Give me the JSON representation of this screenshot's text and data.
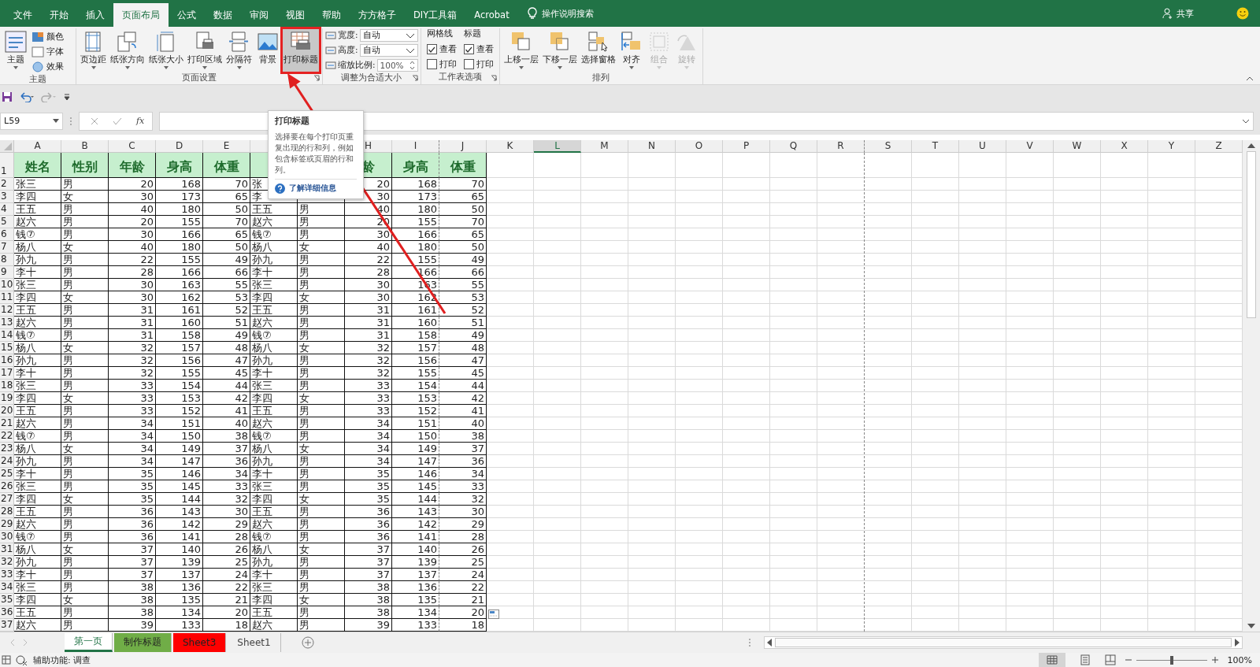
{
  "title_bar": {
    "tabs": [
      {
        "label": "文件",
        "selected": false
      },
      {
        "label": "开始",
        "selected": false
      },
      {
        "label": "插入",
        "selected": false
      },
      {
        "label": "页面布局",
        "selected": true
      },
      {
        "label": "公式",
        "selected": false
      },
      {
        "label": "数据",
        "selected": false
      },
      {
        "label": "审阅",
        "selected": false
      },
      {
        "label": "视图",
        "selected": false
      },
      {
        "label": "帮助",
        "selected": false
      },
      {
        "label": "方方格子",
        "selected": false
      },
      {
        "label": "DIY工具箱",
        "selected": false
      },
      {
        "label": "Acrobat",
        "selected": false
      }
    ],
    "search": "操作说明搜索",
    "share": "共享"
  },
  "ribbon": {
    "theme": {
      "label": "主题",
      "button": "主题",
      "small": [
        "颜色",
        "字体",
        "效果"
      ]
    },
    "page_setup": {
      "label": "页面设置",
      "buttons": [
        {
          "label": "页边距",
          "highlighted": false
        },
        {
          "label": "纸张方向",
          "highlighted": false
        },
        {
          "label": "纸张大小",
          "highlighted": false
        },
        {
          "label": "打印区域",
          "highlighted": false
        },
        {
          "label": "分隔符",
          "highlighted": false
        },
        {
          "label": "背景",
          "highlighted": false
        },
        {
          "label": "打印标题",
          "highlighted": true
        }
      ]
    },
    "fit": {
      "label": "调整为合适大小",
      "fields": [
        {
          "label": "宽度:",
          "value": "自动",
          "kind": "dropdown"
        },
        {
          "label": "高度:",
          "value": "自动",
          "kind": "dropdown"
        },
        {
          "label": "缩放比例:",
          "value": "100%",
          "kind": "spinner"
        }
      ]
    },
    "sheet_options": {
      "label": "工作表选项",
      "columns": [
        {
          "title": "网格线",
          "options": [
            {
              "label": "查看",
              "checked": true
            },
            {
              "label": "打印",
              "checked": false
            }
          ]
        },
        {
          "title": "标题",
          "options": [
            {
              "label": "查看",
              "checked": true
            },
            {
              "label": "打印",
              "checked": false
            }
          ]
        }
      ]
    },
    "arrange": {
      "label": "排列",
      "buttons": [
        {
          "label": "上移一层",
          "disabled": false
        },
        {
          "label": "下移一层",
          "disabled": false
        },
        {
          "label": "选择窗格",
          "disabled": false
        },
        {
          "label": "对齐",
          "disabled": false
        },
        {
          "label": "组合",
          "disabled": true
        },
        {
          "label": "旋转",
          "disabled": true
        }
      ]
    }
  },
  "formula_bar": {
    "name_box": "L59",
    "function_label": "fx"
  },
  "tooltip": {
    "title": "打印标题",
    "body": "选择要在每个打印页重复出现的行和列，例如包含标签或页眉的行和列。",
    "link": "了解详细信息"
  },
  "sheet": {
    "columns": [
      {
        "letter": "A",
        "kind": "text",
        "selected": false,
        "page_break": false
      },
      {
        "letter": "B",
        "kind": "text",
        "selected": false,
        "page_break": false
      },
      {
        "letter": "C",
        "kind": "number",
        "selected": false,
        "page_break": false
      },
      {
        "letter": "D",
        "kind": "number",
        "selected": false,
        "page_break": false
      },
      {
        "letter": "E",
        "kind": "number",
        "selected": false,
        "page_break": false
      },
      {
        "kind": "text"
      },
      {
        "kind": "text"
      },
      {
        "letter": "H",
        "kind": "number",
        "selected": false,
        "page_break": false
      },
      {
        "letter": "I",
        "kind": "number",
        "selected": false,
        "page_break": true
      },
      {
        "letter": "J",
        "kind": "number",
        "selected": false,
        "page_break": false
      },
      {
        "letter": "K",
        "selected": false,
        "page_break": false
      },
      {
        "letter": "L",
        "selected": true,
        "page_break": false
      },
      {
        "letter": "M",
        "selected": false,
        "page_break": false
      },
      {
        "letter": "N",
        "selected": false,
        "page_break": false
      },
      {
        "letter": "O",
        "selected": false,
        "page_break": false
      },
      {
        "letter": "P",
        "selected": false,
        "page_break": false
      },
      {
        "letter": "Q",
        "selected": false,
        "page_break": false
      },
      {
        "letter": "R",
        "selected": false,
        "page_break": true
      },
      {
        "letter": "S",
        "selected": false,
        "page_break": false
      },
      {
        "letter": "T",
        "selected": false,
        "page_break": false
      },
      {
        "letter": "U",
        "selected": false,
        "page_break": false
      },
      {
        "letter": "V",
        "selected": false,
        "page_break": false
      },
      {
        "letter": "W",
        "selected": false,
        "page_break": false
      },
      {
        "letter": "X",
        "selected": false,
        "page_break": false
      },
      {
        "letter": "Y",
        "selected": false,
        "page_break": false
      },
      {
        "letter": "Z",
        "selected": false,
        "page_break": false
      }
    ],
    "rows": [
      {
        "number": "1",
        "kind": "header",
        "cells": [
          "姓名",
          "性别",
          "年龄",
          "身高",
          "体重",
          null,
          null,
          "龄",
          "身高",
          "体重"
        ]
      },
      {
        "number": "2",
        "kind": "data",
        "cells": [
          "张三",
          "男",
          "20",
          "168",
          "70",
          "张",
          null,
          "20",
          "168",
          "70"
        ]
      },
      {
        "number": "3",
        "kind": "data",
        "cells": [
          "李四",
          "女",
          "30",
          "173",
          "65",
          "李",
          null,
          "30",
          "173",
          "65"
        ]
      },
      {
        "number": "4",
        "kind": "data",
        "cells": [
          "王五",
          "男",
          "40",
          "180",
          "50",
          "王五",
          "男",
          "40",
          "180",
          "50"
        ]
      },
      {
        "number": "5",
        "kind": "data",
        "cells": [
          "赵六",
          "男",
          "20",
          "155",
          "70",
          "赵六",
          "男",
          "20",
          "155",
          "70"
        ]
      },
      {
        "number": "6",
        "kind": "data",
        "cells": [
          "钱⑦",
          "男",
          "30",
          "166",
          "65",
          "钱⑦",
          "男",
          "30",
          "166",
          "65"
        ]
      },
      {
        "number": "7",
        "kind": "data",
        "cells": [
          "杨八",
          "女",
          "40",
          "180",
          "50",
          "杨八",
          "女",
          "40",
          "180",
          "50"
        ]
      },
      {
        "number": "8",
        "kind": "data",
        "cells": [
          "孙九",
          "男",
          "22",
          "155",
          "49",
          "孙九",
          "男",
          "22",
          "155",
          "49"
        ]
      },
      {
        "number": "9",
        "kind": "data",
        "cells": [
          "李十",
          "男",
          "28",
          "166",
          "66",
          "李十",
          "男",
          "28",
          "166",
          "66"
        ]
      },
      {
        "number": "10",
        "kind": "data",
        "cells": [
          "张三",
          "男",
          "30",
          "163",
          "55",
          "张三",
          "男",
          "30",
          "163",
          "55"
        ]
      },
      {
        "number": "11",
        "kind": "data",
        "cells": [
          "李四",
          "女",
          "30",
          "162",
          "53",
          "李四",
          "女",
          "30",
          "162",
          "53"
        ]
      },
      {
        "number": "12",
        "kind": "data",
        "cells": [
          "王五",
          "男",
          "31",
          "161",
          "52",
          "王五",
          "男",
          "31",
          "161",
          "52"
        ]
      },
      {
        "number": "13",
        "kind": "data",
        "cells": [
          "赵六",
          "男",
          "31",
          "160",
          "51",
          "赵六",
          "男",
          "31",
          "160",
          "51"
        ]
      },
      {
        "number": "14",
        "kind": "data",
        "cells": [
          "钱⑦",
          "男",
          "31",
          "158",
          "49",
          "钱⑦",
          "男",
          "31",
          "158",
          "49"
        ]
      },
      {
        "number": "15",
        "kind": "data",
        "cells": [
          "杨八",
          "女",
          "32",
          "157",
          "48",
          "杨八",
          "女",
          "32",
          "157",
          "48"
        ]
      },
      {
        "number": "16",
        "kind": "data",
        "cells": [
          "孙九",
          "男",
          "32",
          "156",
          "47",
          "孙九",
          "男",
          "32",
          "156",
          "47"
        ]
      },
      {
        "number": "17",
        "kind": "data",
        "cells": [
          "李十",
          "男",
          "32",
          "155",
          "45",
          "李十",
          "男",
          "32",
          "155",
          "45"
        ]
      },
      {
        "number": "18",
        "kind": "data",
        "cells": [
          "张三",
          "男",
          "33",
          "154",
          "44",
          "张三",
          "男",
          "33",
          "154",
          "44"
        ]
      },
      {
        "number": "19",
        "kind": "data",
        "cells": [
          "李四",
          "女",
          "33",
          "153",
          "42",
          "李四",
          "女",
          "33",
          "153",
          "42"
        ]
      },
      {
        "number": "20",
        "kind": "data",
        "cells": [
          "王五",
          "男",
          "33",
          "152",
          "41",
          "王五",
          "男",
          "33",
          "152",
          "41"
        ]
      },
      {
        "number": "21",
        "kind": "data",
        "cells": [
          "赵六",
          "男",
          "34",
          "151",
          "40",
          "赵六",
          "男",
          "34",
          "151",
          "40"
        ]
      },
      {
        "number": "22",
        "kind": "data",
        "cells": [
          "钱⑦",
          "男",
          "34",
          "150",
          "38",
          "钱⑦",
          "男",
          "34",
          "150",
          "38"
        ]
      },
      {
        "number": "23",
        "kind": "data",
        "cells": [
          "杨八",
          "女",
          "34",
          "149",
          "37",
          "杨八",
          "女",
          "34",
          "149",
          "37"
        ]
      },
      {
        "number": "24",
        "kind": "data",
        "cells": [
          "孙九",
          "男",
          "34",
          "147",
          "36",
          "孙九",
          "男",
          "34",
          "147",
          "36"
        ]
      },
      {
        "number": "25",
        "kind": "data",
        "cells": [
          "李十",
          "男",
          "35",
          "146",
          "34",
          "李十",
          "男",
          "35",
          "146",
          "34"
        ]
      },
      {
        "number": "26",
        "kind": "data",
        "cells": [
          "张三",
          "男",
          "35",
          "145",
          "33",
          "张三",
          "男",
          "35",
          "145",
          "33"
        ]
      },
      {
        "number": "27",
        "kind": "data",
        "cells": [
          "李四",
          "女",
          "35",
          "144",
          "32",
          "李四",
          "女",
          "35",
          "144",
          "32"
        ]
      },
      {
        "number": "28",
        "kind": "data",
        "cells": [
          "王五",
          "男",
          "36",
          "143",
          "30",
          "王五",
          "男",
          "36",
          "143",
          "30"
        ]
      },
      {
        "number": "29",
        "kind": "data",
        "cells": [
          "赵六",
          "男",
          "36",
          "142",
          "29",
          "赵六",
          "男",
          "36",
          "142",
          "29"
        ]
      },
      {
        "number": "30",
        "kind": "data",
        "cells": [
          "钱⑦",
          "男",
          "36",
          "141",
          "28",
          "钱⑦",
          "男",
          "36",
          "141",
          "28"
        ]
      },
      {
        "number": "31",
        "kind": "data",
        "cells": [
          "杨八",
          "女",
          "37",
          "140",
          "26",
          "杨八",
          "女",
          "37",
          "140",
          "26"
        ]
      },
      {
        "number": "32",
        "kind": "data",
        "cells": [
          "孙九",
          "男",
          "37",
          "139",
          "25",
          "孙九",
          "男",
          "37",
          "139",
          "25"
        ]
      },
      {
        "number": "33",
        "kind": "data",
        "cells": [
          "李十",
          "男",
          "37",
          "137",
          "24",
          "李十",
          "男",
          "37",
          "137",
          "24"
        ]
      },
      {
        "number": "34",
        "kind": "data",
        "cells": [
          "张三",
          "男",
          "38",
          "136",
          "22",
          "张三",
          "男",
          "38",
          "136",
          "22"
        ]
      },
      {
        "number": "35",
        "kind": "data",
        "cells": [
          "李四",
          "女",
          "38",
          "135",
          "21",
          "李四",
          "女",
          "38",
          "135",
          "21"
        ]
      },
      {
        "number": "36",
        "kind": "data",
        "cells": [
          "王五",
          "男",
          "38",
          "134",
          "20",
          "王五",
          "男",
          "38",
          "134",
          "20"
        ]
      },
      {
        "number": "37",
        "kind": "data",
        "cells": [
          "赵六",
          "男",
          "39",
          "133",
          "18",
          "赵六",
          "男",
          "39",
          "133",
          "18"
        ]
      }
    ]
  },
  "sheet_tabs": [
    {
      "label": "第一页",
      "selected": true
    },
    {
      "label": "制作标题",
      "selected": false,
      "color": "#70ad47"
    },
    {
      "label": "Sheet3",
      "selected": false,
      "color": "#ff0000"
    },
    {
      "label": "Sheet1",
      "selected": false
    }
  ],
  "status_bar": {
    "accessibility": "辅助功能: 调查",
    "zoom": "100%",
    "zoom_slider": {
      "level": 0.5
    }
  }
}
